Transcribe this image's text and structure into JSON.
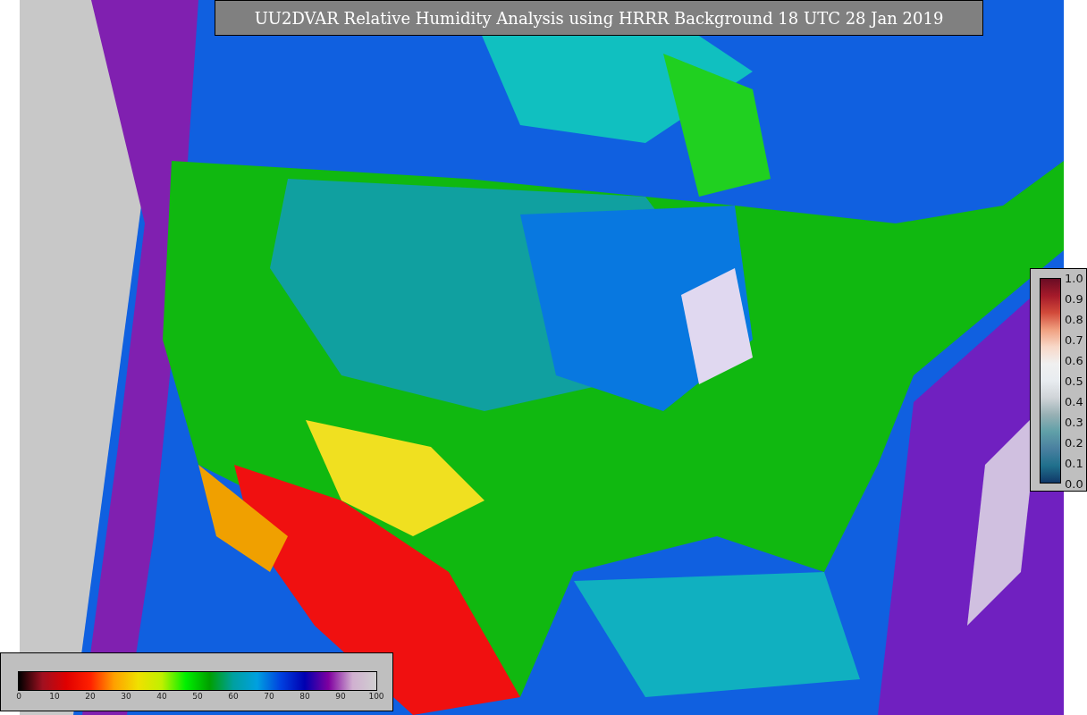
{
  "title": "UU2DVAR Relative Humidity Analysis using HRRR Background 18 UTC 28 Jan 2019",
  "humidity_legend": {
    "ticks": [
      "0",
      "10",
      "20",
      "30",
      "40",
      "50",
      "60",
      "70",
      "80",
      "90",
      "100"
    ]
  },
  "weight_legend": {
    "ticks": [
      "1.0",
      "0.9",
      "0.8",
      "0.7",
      "0.6",
      "0.5",
      "0.4",
      "0.3",
      "0.2",
      "0.1",
      "0.0"
    ]
  }
}
